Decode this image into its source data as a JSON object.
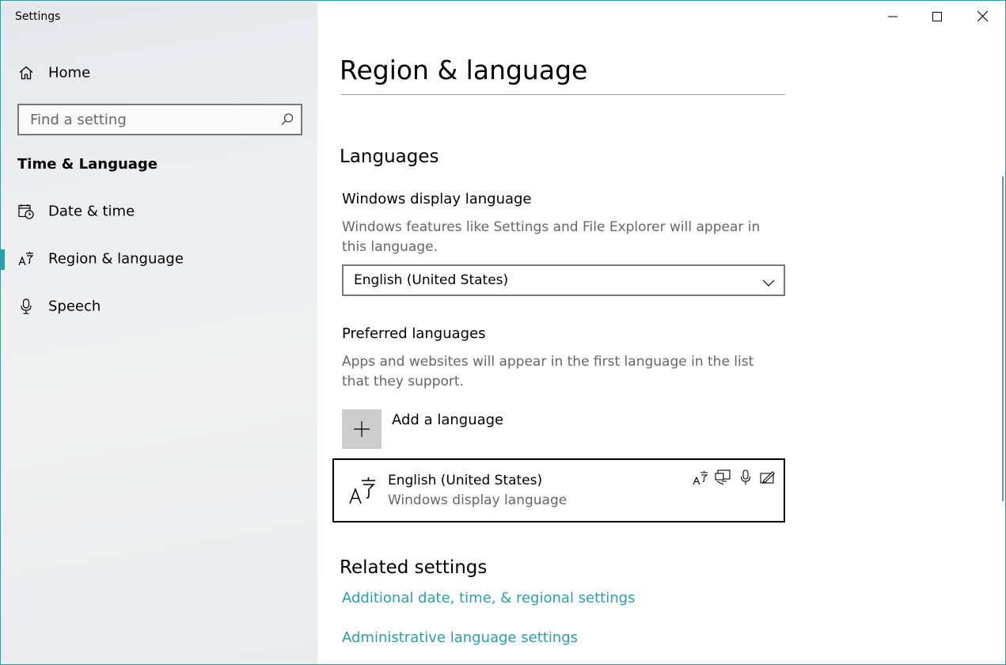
{
  "window": {
    "title": "Settings",
    "accent_color": "#2b9fa8"
  },
  "caption_buttons": {
    "minimize": "minimize-icon",
    "maximize": "maximize-icon",
    "close": "close-icon"
  },
  "sidebar": {
    "home_label": "Home",
    "search": {
      "placeholder": "Find a setting",
      "value": ""
    },
    "section_label": "Time & Language",
    "items": [
      {
        "label": "Date & time",
        "icon": "calendar-clock-icon",
        "selected": false
      },
      {
        "label": "Region & language",
        "icon": "language-icon",
        "selected": true
      },
      {
        "label": "Speech",
        "icon": "microphone-icon",
        "selected": false
      }
    ]
  },
  "main": {
    "page_title": "Region & language",
    "languages_heading": "Languages",
    "display_language": {
      "heading": "Windows display language",
      "description": "Windows features like Settings and File Explorer will appear in this language.",
      "selected": "English (United States)"
    },
    "preferred": {
      "heading": "Preferred languages",
      "description": "Apps and websites will appear in the first language in the list that they support.",
      "add_label": "Add a language",
      "languages": [
        {
          "name": "English (United States)",
          "sub": "Windows display language",
          "features": [
            "language-pack-icon",
            "display-language-icon",
            "speech-icon",
            "handwriting-icon"
          ]
        }
      ]
    },
    "related": {
      "heading": "Related settings",
      "links": [
        "Additional date, time, & regional settings",
        "Administrative language settings"
      ]
    }
  }
}
